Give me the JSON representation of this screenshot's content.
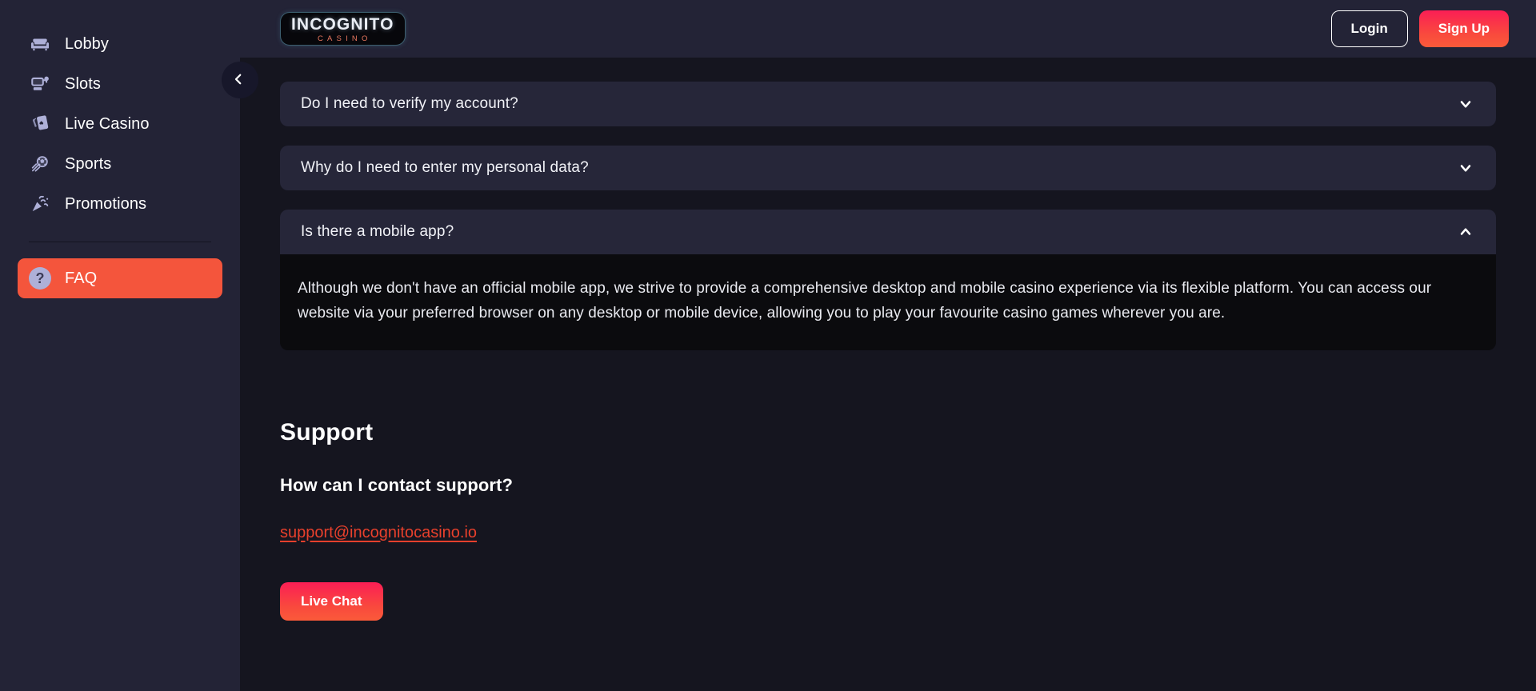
{
  "sidebar": {
    "items": [
      {
        "label": "Lobby",
        "icon": "sofa-icon",
        "active": false
      },
      {
        "label": "Slots",
        "icon": "slot-machine-icon",
        "active": false
      },
      {
        "label": "Live Casino",
        "icon": "playing-cards-icon",
        "active": false
      },
      {
        "label": "Sports",
        "icon": "soccer-ball-icon",
        "active": false
      },
      {
        "label": "Promotions",
        "icon": "party-popper-icon",
        "active": false
      }
    ],
    "footer_items": [
      {
        "label": "FAQ",
        "icon": "question-mark-icon",
        "active": true
      }
    ],
    "collapse_toggle_icon": "chevron-left-icon"
  },
  "topbar": {
    "logo": {
      "main": "INCOGNITO",
      "sub": "CASINO"
    },
    "login_label": "Login",
    "signup_label": "Sign Up"
  },
  "faq": {
    "items": [
      {
        "question": "Do I need to verify my account?",
        "expanded": false,
        "chevron": "chevron-down-icon",
        "answer": ""
      },
      {
        "question": "Why do I need to enter my personal data?",
        "expanded": false,
        "chevron": "chevron-down-icon",
        "answer": ""
      },
      {
        "question": "Is there a mobile app?",
        "expanded": true,
        "chevron": "chevron-up-icon",
        "answer": "Although we don't have an official mobile app, we strive to provide a comprehensive desktop and mobile casino experience via its flexible platform. You can access our website via your preferred browser on any desktop or mobile device, allowing you to play your favourite casino games wherever you are."
      }
    ]
  },
  "support": {
    "title": "Support",
    "subtitle": "How can I contact support?",
    "email": "support@incognitocasino.io",
    "live_chat_label": "Live Chat"
  },
  "colors": {
    "accent": "#f4553c",
    "accent_gradient_top": "#fb1e55",
    "accent_gradient_bottom": "#fa5a3a",
    "sidebar_bg": "#232336",
    "main_bg": "#15151f",
    "card_bg": "#262639",
    "answer_bg": "#0b0b0e",
    "link": "#e8402c",
    "icon": "#aeb0d8",
    "logo_sub": "#e8775f"
  }
}
